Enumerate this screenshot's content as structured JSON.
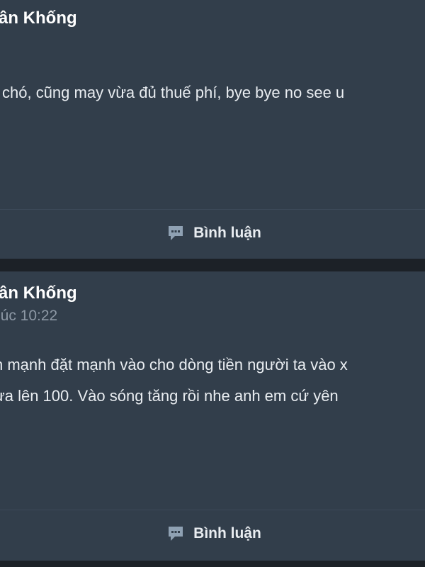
{
  "posts": [
    {
      "author": "ân Khống",
      "time": "",
      "lines": [
        "i chó, cũng may vừa đủ thuế phí, bye bye no see u"
      ],
      "comment_label": "Bình luận"
    },
    {
      "author": "ân Khống",
      "time": "lúc 10:22",
      "lines": [
        "n mạnh đặt mạnh vào cho dòng tiền người ta vào x",
        "ừa lên 100. Vào sóng tăng rồi nhe anh em cứ yên"
      ],
      "comment_label": "Bình luận"
    }
  ],
  "icons": {
    "comment": "comment-bubble-icon"
  },
  "colors": {
    "background": "#1c2127",
    "card": "#323e4b",
    "divider": "#3c4958",
    "text": "#e9edf1",
    "muted": "#8d98a5"
  }
}
